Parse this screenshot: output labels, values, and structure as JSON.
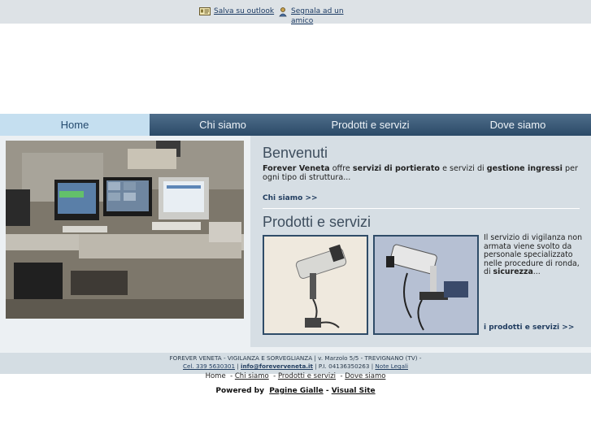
{
  "toplinks": {
    "outlook": "Salva su outlook",
    "friend": "Segnala ad un amico"
  },
  "nav": {
    "items": [
      "Home",
      "Chi siamo",
      "Prodotti e servizi",
      "Dove siamo"
    ],
    "active_index": 0
  },
  "welcome": {
    "title": "Benvenuti",
    "company": "Forever Veneta",
    "t1": " offre ",
    "b1": "servizi di portierato",
    "t2": " e servizi di ",
    "b2": "gestione ingressi",
    "t3": " per ogni tipo di struttura...",
    "more": "Chi siamo >>"
  },
  "products": {
    "title": "Prodotti e servizi",
    "text": "Il servizio di vigilanza non armata viene svolto da personale specializzato nelle procedure di ronda, di ",
    "bold": "sicurezza",
    "text_end": "...",
    "more": "i prodotti e servizi >>"
  },
  "footer": {
    "line1": "FOREVER VENETA - VIGILANZA E SORVEGLIANZA | v. Marzolo 5/5 - TREVIGNANO (TV) -",
    "phone": "Cel. 339 5630301",
    "sep1": " | ",
    "email": "info@foreverveneta.it",
    "piva": " | P.I. 04136350263 | ",
    "legal": "Note Legali",
    "nav": [
      "Home",
      "Chi siamo",
      "Prodotti e servizi",
      "Dove siamo"
    ],
    "powered_by": "Powered by",
    "pagine": "Pagine Gialle",
    "dash": " - ",
    "visual": "Visual Site"
  },
  "colors": {
    "nav_dark": "#2b4a67",
    "nav_active": "#c5dff0",
    "panel": "#d6dee4",
    "link": "#1f3b5e"
  }
}
